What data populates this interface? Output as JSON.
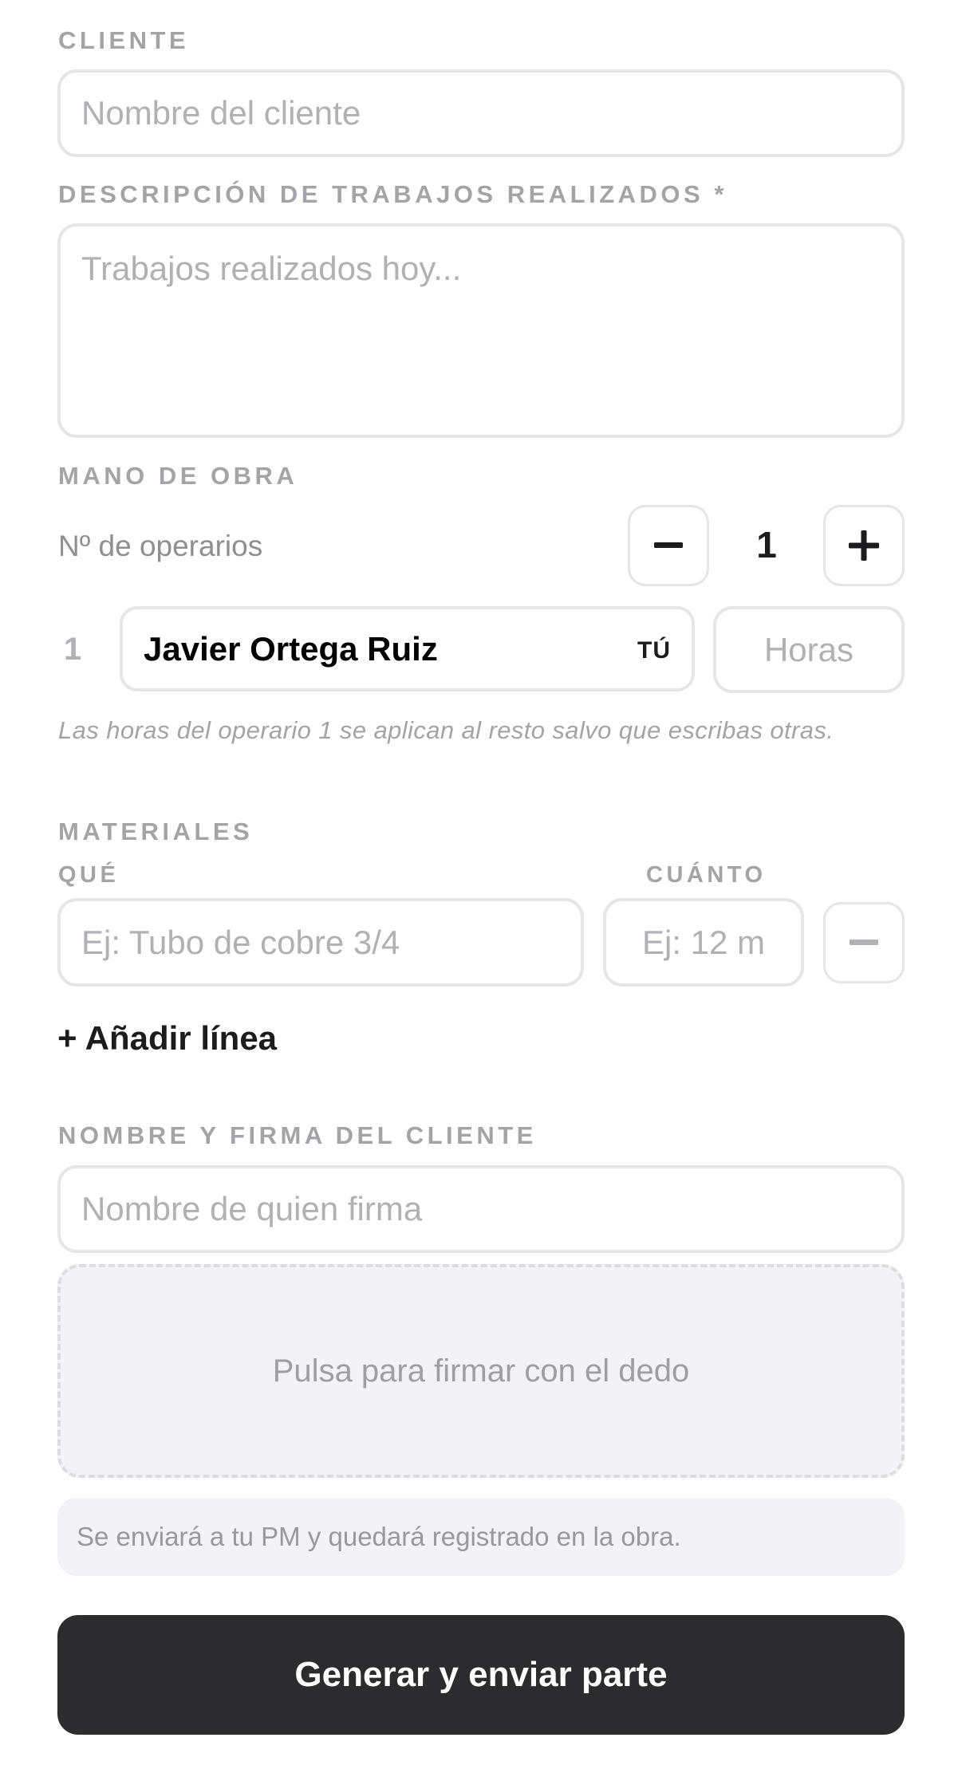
{
  "cliente": {
    "label": "CLIENTE",
    "placeholder": "Nombre del cliente",
    "value": ""
  },
  "descripcion": {
    "label": "DESCRIPCIÓN DE TRABAJOS REALIZADOS *",
    "placeholder": "Trabajos realizados hoy...",
    "value": ""
  },
  "mano_de_obra": {
    "label": "MANO DE OBRA",
    "operarios_label": "Nº de operarios",
    "count": "1",
    "operarios": [
      {
        "index": "1",
        "name": "Javier Ortega Ruiz",
        "badge": "TÚ",
        "hours_placeholder": "Horas",
        "hours_value": ""
      }
    ],
    "hint": "Las horas del operario 1 se aplican al resto salvo que escribas otras."
  },
  "materiales": {
    "label": "MATERIALES",
    "que_label": "QUÉ",
    "cuanto_label": "CUÁNTO",
    "lines": [
      {
        "que_placeholder": "Ej: Tubo de cobre 3/4",
        "que_value": "",
        "cuanto_placeholder": "Ej: 12 m",
        "cuanto_value": ""
      }
    ],
    "add_label": "+ Añadir línea"
  },
  "firma": {
    "label": "NOMBRE Y FIRMA DEL CLIENTE",
    "name_placeholder": "Nombre de quien firma",
    "name_value": "",
    "pad_text": "Pulsa para firmar con el dedo"
  },
  "notice": "Se enviará a tu PM y quedará registrado en la obra.",
  "submit_label": "Generar y enviar parte",
  "colors": {
    "label_gray": "#a3a3a8",
    "border": "#e5e5ea",
    "button_dark": "#2c2c2e",
    "panel_bg": "#f2f2f7"
  }
}
